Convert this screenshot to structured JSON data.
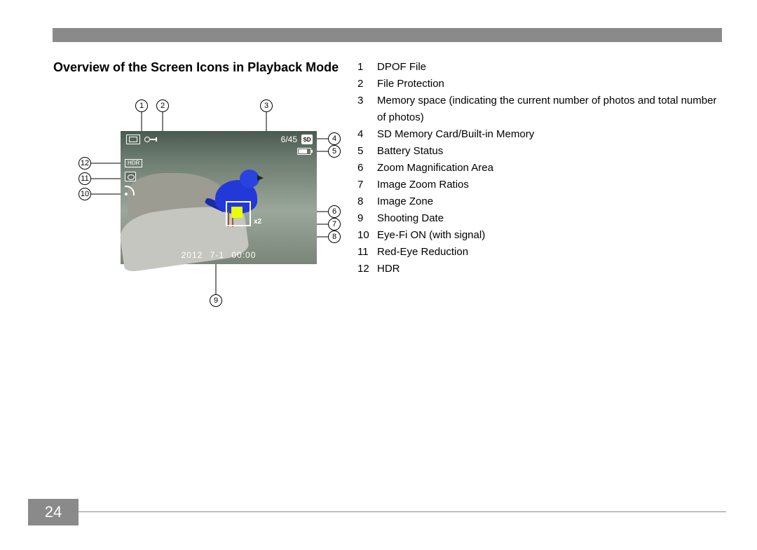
{
  "page_number": "24",
  "title": "Overview of the Screen Icons in Playback Mode",
  "osd": {
    "memory_counter": "6/45",
    "sd_label": "SD",
    "hdr_label": "HDR",
    "zoom_ratio": "x2",
    "date_line": "2012  7-1  00:00"
  },
  "callouts": [
    "1",
    "2",
    "3",
    "4",
    "5",
    "6",
    "7",
    "8",
    "9",
    "10",
    "11",
    "12"
  ],
  "legend": [
    {
      "n": "1",
      "t": "DPOF File"
    },
    {
      "n": "2",
      "t": "File Protection"
    },
    {
      "n": "3",
      "t": "Memory space (indicating the current number of photos and total number of photos)"
    },
    {
      "n": "4",
      "t": "SD Memory Card/Built-in Memory"
    },
    {
      "n": "5",
      "t": "Battery Status"
    },
    {
      "n": "6",
      "t": "Zoom Magnification Area"
    },
    {
      "n": "7",
      "t": "Image Zoom Ratios"
    },
    {
      "n": "8",
      "t": "Image Zone"
    },
    {
      "n": "9",
      "t": "Shooting Date"
    },
    {
      "n": "10",
      "t": "Eye-Fi ON (with signal)"
    },
    {
      "n": "11",
      "t": "Red-Eye Reduction"
    },
    {
      "n": "12",
      "t": "HDR"
    }
  ]
}
